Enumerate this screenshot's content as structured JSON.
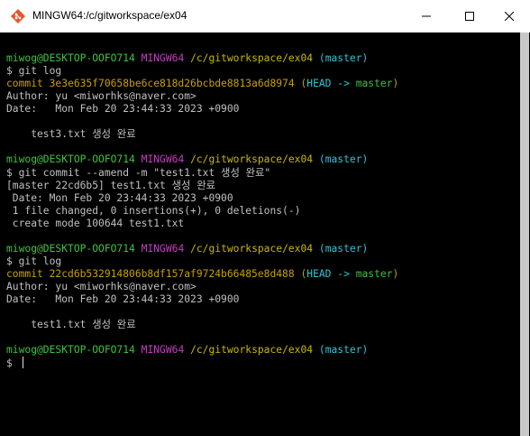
{
  "window": {
    "title": "MINGW64:/c/gitworkspace/ex04"
  },
  "terminal": {
    "lines": [
      {
        "segments": []
      },
      {
        "segments": [
          {
            "text": "miwog@DESKTOP-OOFO714 ",
            "color": "green"
          },
          {
            "text": "MINGW64 ",
            "color": "magenta"
          },
          {
            "text": "/c/gitworkspace/ex04 ",
            "color": "yellow"
          },
          {
            "text": "(master)",
            "color": "cyan"
          }
        ]
      },
      {
        "segments": [
          {
            "text": "$ git log",
            "color": "default"
          }
        ]
      },
      {
        "segments": [
          {
            "text": "commit 3e3e635f70658be6ce818d26bcbde8813a6d8974 ",
            "color": "orange"
          },
          {
            "text": "(",
            "color": "orange"
          },
          {
            "text": "HEAD -> ",
            "color": "cyan"
          },
          {
            "text": "master",
            "color": "green"
          },
          {
            "text": ")",
            "color": "orange"
          }
        ]
      },
      {
        "segments": [
          {
            "text": "Author: yu <miworhks@naver.com>",
            "color": "default"
          }
        ]
      },
      {
        "segments": [
          {
            "text": "Date:   Mon Feb 20 23:44:33 2023 +0900",
            "color": "default"
          }
        ]
      },
      {
        "segments": []
      },
      {
        "segments": [
          {
            "text": "    test3.txt 생성 완료",
            "color": "default"
          }
        ]
      },
      {
        "segments": []
      },
      {
        "segments": [
          {
            "text": "miwog@DESKTOP-OOFO714 ",
            "color": "green"
          },
          {
            "text": "MINGW64 ",
            "color": "magenta"
          },
          {
            "text": "/c/gitworkspace/ex04 ",
            "color": "yellow"
          },
          {
            "text": "(master)",
            "color": "cyan"
          }
        ]
      },
      {
        "segments": [
          {
            "text": "$ git commit --amend -m \"test1.txt 생성 완료\"",
            "color": "default"
          }
        ]
      },
      {
        "segments": [
          {
            "text": "[master 22cd6b5] test1.txt 생성 완료",
            "color": "default"
          }
        ]
      },
      {
        "segments": [
          {
            "text": " Date: Mon Feb 20 23:44:33 2023 +0900",
            "color": "default"
          }
        ]
      },
      {
        "segments": [
          {
            "text": " 1 file changed, 0 insertions(+), 0 deletions(-)",
            "color": "default"
          }
        ]
      },
      {
        "segments": [
          {
            "text": " create mode 100644 test1.txt",
            "color": "default"
          }
        ]
      },
      {
        "segments": []
      },
      {
        "segments": [
          {
            "text": "miwog@DESKTOP-OOFO714 ",
            "color": "green"
          },
          {
            "text": "MINGW64 ",
            "color": "magenta"
          },
          {
            "text": "/c/gitworkspace/ex04 ",
            "color": "yellow"
          },
          {
            "text": "(master)",
            "color": "cyan"
          }
        ]
      },
      {
        "segments": [
          {
            "text": "$ git log",
            "color": "default"
          }
        ]
      },
      {
        "segments": [
          {
            "text": "commit 22cd6b532914806b8df157af9724b66485e8d488 ",
            "color": "orange"
          },
          {
            "text": "(",
            "color": "orange"
          },
          {
            "text": "HEAD -> ",
            "color": "cyan"
          },
          {
            "text": "master",
            "color": "green"
          },
          {
            "text": ")",
            "color": "orange"
          }
        ]
      },
      {
        "segments": [
          {
            "text": "Author: yu <miworhks@naver.com>",
            "color": "default"
          }
        ]
      },
      {
        "segments": [
          {
            "text": "Date:   Mon Feb 20 23:44:33 2023 +0900",
            "color": "default"
          }
        ]
      },
      {
        "segments": []
      },
      {
        "segments": [
          {
            "text": "    test1.txt 생성 완료",
            "color": "default"
          }
        ]
      },
      {
        "segments": []
      },
      {
        "segments": [
          {
            "text": "miwog@DESKTOP-OOFO714 ",
            "color": "green"
          },
          {
            "text": "MINGW64 ",
            "color": "magenta"
          },
          {
            "text": "/c/gitworkspace/ex04 ",
            "color": "yellow"
          },
          {
            "text": "(master)",
            "color": "cyan"
          }
        ]
      },
      {
        "segments": [
          {
            "text": "$ ",
            "color": "default"
          }
        ],
        "cursor": true
      }
    ]
  },
  "colors": {
    "green": "#3ec23e",
    "magenta": "#c33ec3",
    "yellow": "#c8b800",
    "cyan": "#2fc5d6",
    "orange": "#c8a000",
    "default": "#c0c0c0"
  }
}
